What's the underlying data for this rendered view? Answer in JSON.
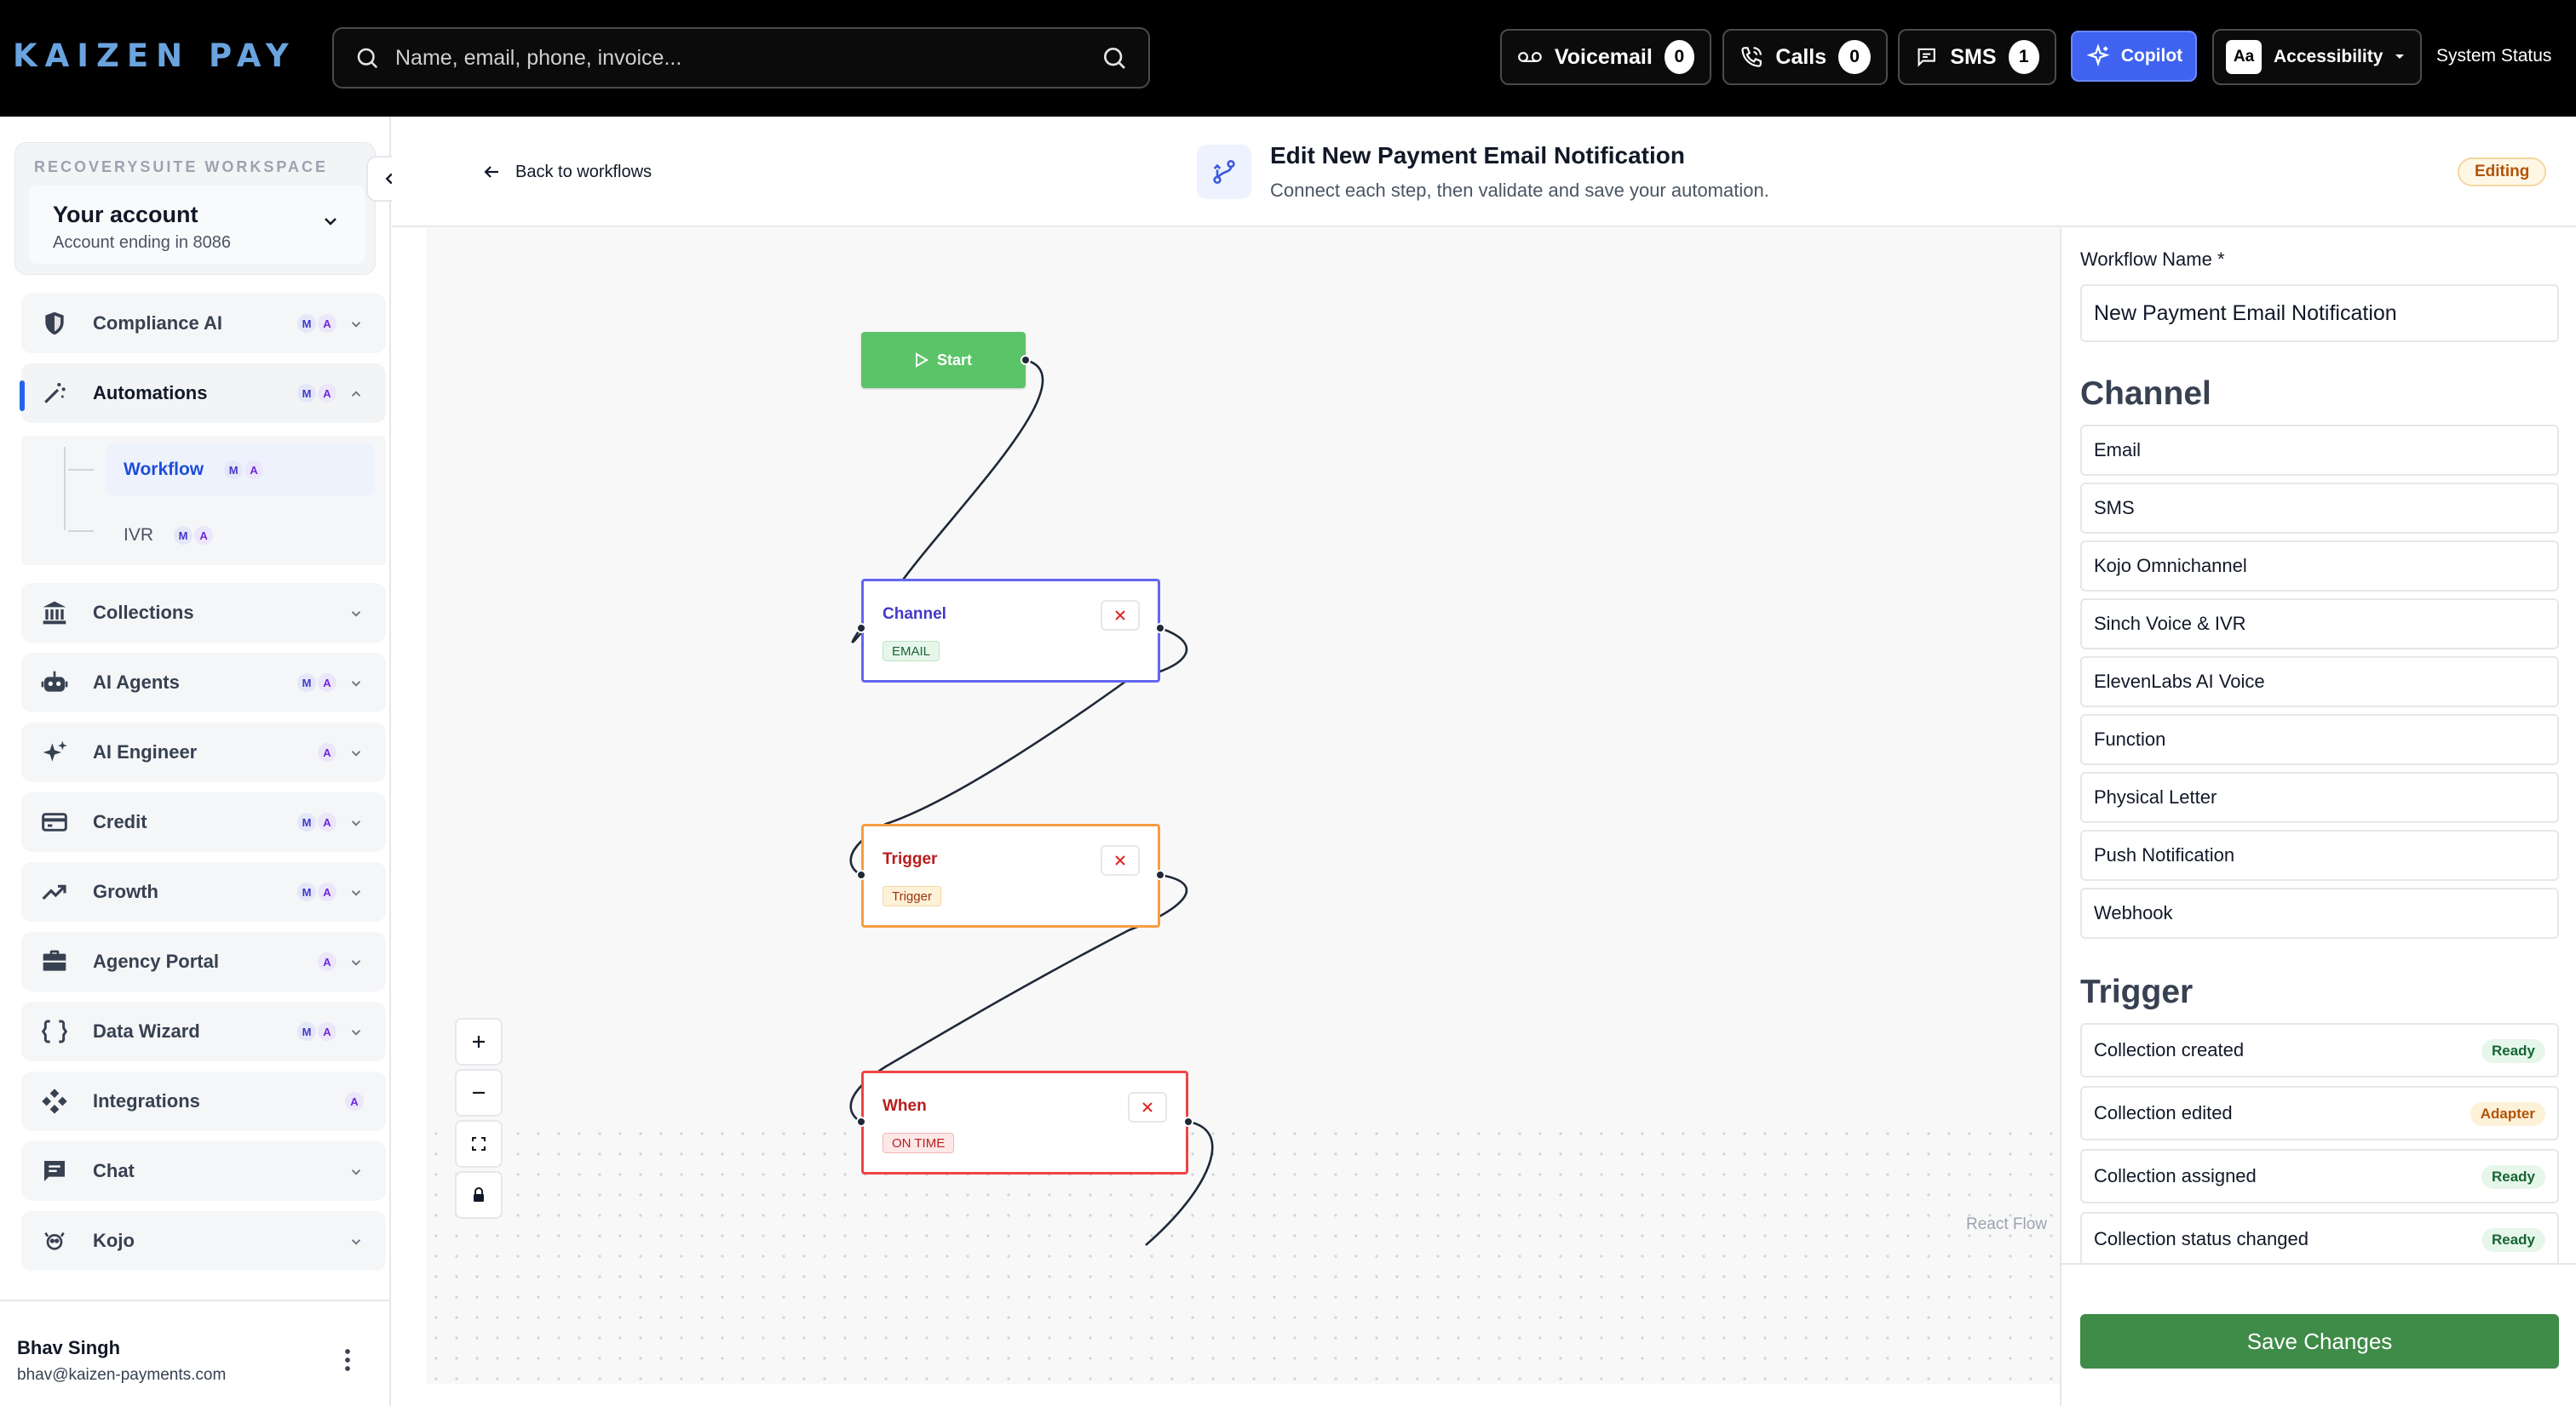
{
  "brand": "KAIZEN PAY",
  "search": {
    "placeholder": "Name, email, phone, invoice..."
  },
  "topbar": {
    "voicemail": {
      "label": "Voicemail",
      "count": "0"
    },
    "calls": {
      "label": "Calls",
      "count": "0"
    },
    "sms": {
      "label": "SMS",
      "count": "1"
    },
    "copilot": "Copilot",
    "accessibility": {
      "icon": "Aa",
      "label": "Accessibility"
    },
    "system_status": "System Status"
  },
  "workspace": {
    "label": "RECOVERYSUITE WORKSPACE",
    "account": "Your account",
    "account_sub": "Account ending in 8086"
  },
  "nav": [
    {
      "label": "Compliance AI",
      "icon": "shield-icon",
      "badges": [
        "M",
        "A"
      ]
    },
    {
      "label": "Automations",
      "icon": "magic-wand-icon",
      "badges": [
        "M",
        "A"
      ]
    },
    {
      "label": "Collections",
      "icon": "bank-icon",
      "badges": []
    },
    {
      "label": "AI Agents",
      "icon": "robot-icon",
      "badges": [
        "M",
        "A"
      ]
    },
    {
      "label": "AI Engineer",
      "icon": "sparkles-icon",
      "badges": [
        "A"
      ]
    },
    {
      "label": "Credit",
      "icon": "credit-card-icon",
      "badges": [
        "M",
        "A"
      ]
    },
    {
      "label": "Growth",
      "icon": "trend-up-icon",
      "badges": [
        "M",
        "A"
      ]
    },
    {
      "label": "Agency Portal",
      "icon": "briefcase-icon",
      "badges": [
        "A"
      ]
    },
    {
      "label": "Data Wizard",
      "icon": "braces-icon",
      "badges": [
        "M",
        "A"
      ]
    },
    {
      "label": "Integrations",
      "icon": "integrations-icon",
      "badges": [
        "A"
      ]
    },
    {
      "label": "Chat",
      "icon": "chat-icon",
      "badges": []
    },
    {
      "label": "Kojo",
      "icon": "kojo-icon",
      "badges": []
    }
  ],
  "subnav": [
    {
      "label": "Workflow",
      "badges": [
        "M",
        "A"
      ]
    },
    {
      "label": "IVR",
      "badges": [
        "M",
        "A"
      ]
    }
  ],
  "user": {
    "name": "Bhav Singh",
    "email": "bhav@kaizen-payments.com"
  },
  "header": {
    "back": "Back to workflows",
    "title": "Edit New Payment Email Notification",
    "subtitle": "Connect each step, then validate and save your automation.",
    "status": "Editing"
  },
  "canvas": {
    "start": "Start",
    "nodes": [
      {
        "title": "Channel",
        "tag": "EMAIL"
      },
      {
        "title": "Trigger",
        "tag": "Trigger"
      },
      {
        "title": "When",
        "tag": "ON TIME"
      }
    ],
    "attribution": "React Flow"
  },
  "panel": {
    "workflow_name_label": "Workflow Name *",
    "workflow_name_value": "New Payment Email Notification",
    "channel_heading": "Channel",
    "channels": [
      "Email",
      "SMS",
      "Kojo Omnichannel",
      "Sinch Voice & IVR",
      "ElevenLabs AI Voice",
      "Function",
      "Physical Letter",
      "Push Notification",
      "Webhook"
    ],
    "trigger_heading": "Trigger",
    "triggers": [
      {
        "label": "Collection created",
        "status": "Ready"
      },
      {
        "label": "Collection edited",
        "status": "Adapter"
      },
      {
        "label": "Collection assigned",
        "status": "Ready"
      },
      {
        "label": "Collection status changed",
        "status": "Ready"
      }
    ],
    "save": "Save Changes"
  },
  "colors": {
    "accent": "#3f63f0",
    "brand": "#6aa4df",
    "start_node": "#5cc468",
    "channel_border": "#6366f1",
    "trigger_border": "#f59e42",
    "when_border": "#ef4444",
    "save": "#3f8b48"
  }
}
